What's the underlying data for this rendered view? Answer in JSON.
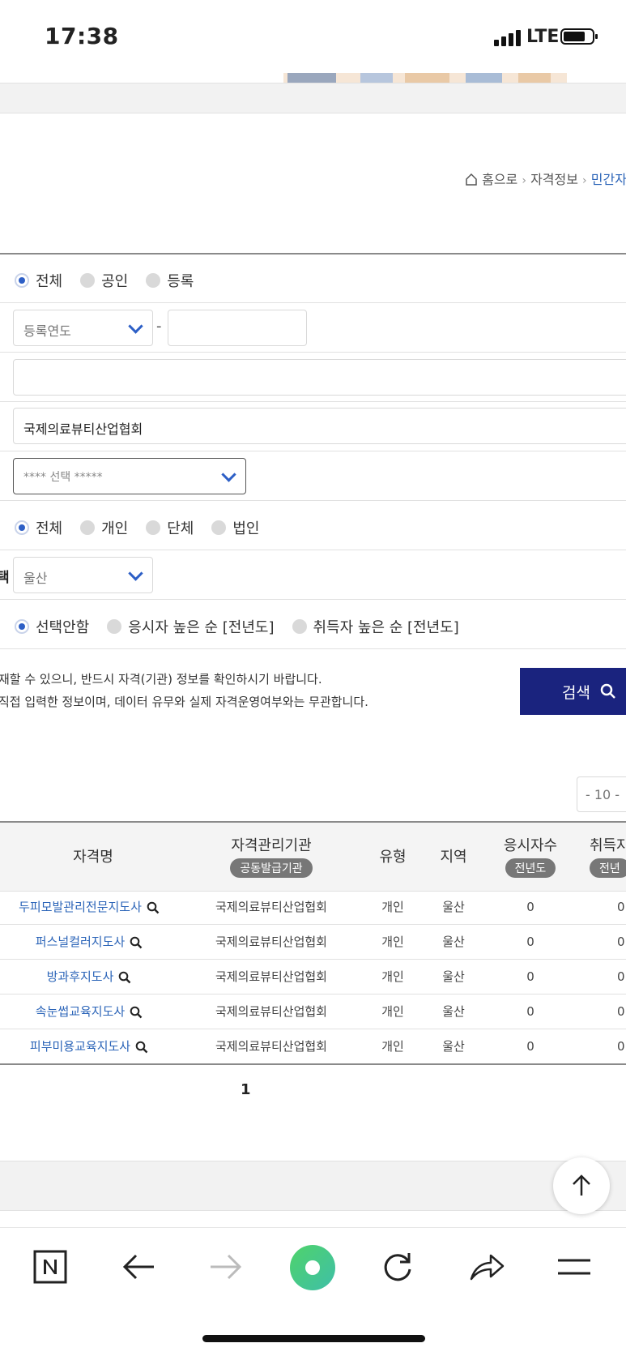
{
  "status_bar": {
    "time": "17:38",
    "network": "LTE"
  },
  "breadcrumb": {
    "home": "홈으로",
    "item1": "자격정보",
    "item2": "민간자"
  },
  "filters": {
    "type_options": [
      "전체",
      "공인",
      "등록"
    ],
    "year_select": "등록연도",
    "year_separator": "-",
    "keyword_value": "",
    "agency_value": "국제의료뷰티산업협회",
    "category_select": "**** 선택 *****",
    "issuer_type_options": [
      "전체",
      "개인",
      "단체",
      "법인"
    ],
    "region_label": "택",
    "region_select": "울산",
    "sort_options": [
      "선택안함",
      "응시자 높은 순 [전년도]",
      "취득자 높은 순 [전년도]"
    ]
  },
  "notice": {
    "line1": "재할 수 있으니, 반드시 자격(기관) 정보를 확인하시기 바랍니다.",
    "line2": "직접 입력한 정보이며, 데이터 유무와 실제 자격운영여부와는 무관합니다."
  },
  "search_button": "검색",
  "page_size": "- 10 -",
  "table": {
    "headers": {
      "name": "자격명",
      "agency": "자격관리기관",
      "agency_sub": "공동발급기관",
      "type": "유형",
      "region": "지역",
      "applicants": "응시자수",
      "applicants_sub": "전년도",
      "acquired": "취득자",
      "acquired_sub": "전년"
    },
    "rows": [
      {
        "name": "두피모발관리전문지도사",
        "agency": "국제의료뷰티산업협회",
        "type": "개인",
        "region": "울산",
        "applicants": "0",
        "acquired": "0"
      },
      {
        "name": "퍼스널컬러지도사",
        "agency": "국제의료뷰티산업협회",
        "type": "개인",
        "region": "울산",
        "applicants": "0",
        "acquired": "0"
      },
      {
        "name": "방과후지도사",
        "agency": "국제의료뷰티산업협회",
        "type": "개인",
        "region": "울산",
        "applicants": "0",
        "acquired": "0"
      },
      {
        "name": "속눈썹교육지도사",
        "agency": "국제의료뷰티산업협회",
        "type": "개인",
        "region": "울산",
        "applicants": "0",
        "acquired": "0"
      },
      {
        "name": "피부미용교육지도사",
        "agency": "국제의료뷰티산업협회",
        "type": "개인",
        "region": "울산",
        "applicants": "0",
        "acquired": "0"
      }
    ]
  },
  "pagination": {
    "current": "1"
  },
  "colors": {
    "accent": "#2d5fc6",
    "button": "#1a237e",
    "link": "#2b64b8"
  },
  "browser_icons": [
    "naver-icon",
    "back-icon",
    "forward-icon",
    "green-dot-icon",
    "reload-icon",
    "share-icon",
    "menu-icon"
  ]
}
